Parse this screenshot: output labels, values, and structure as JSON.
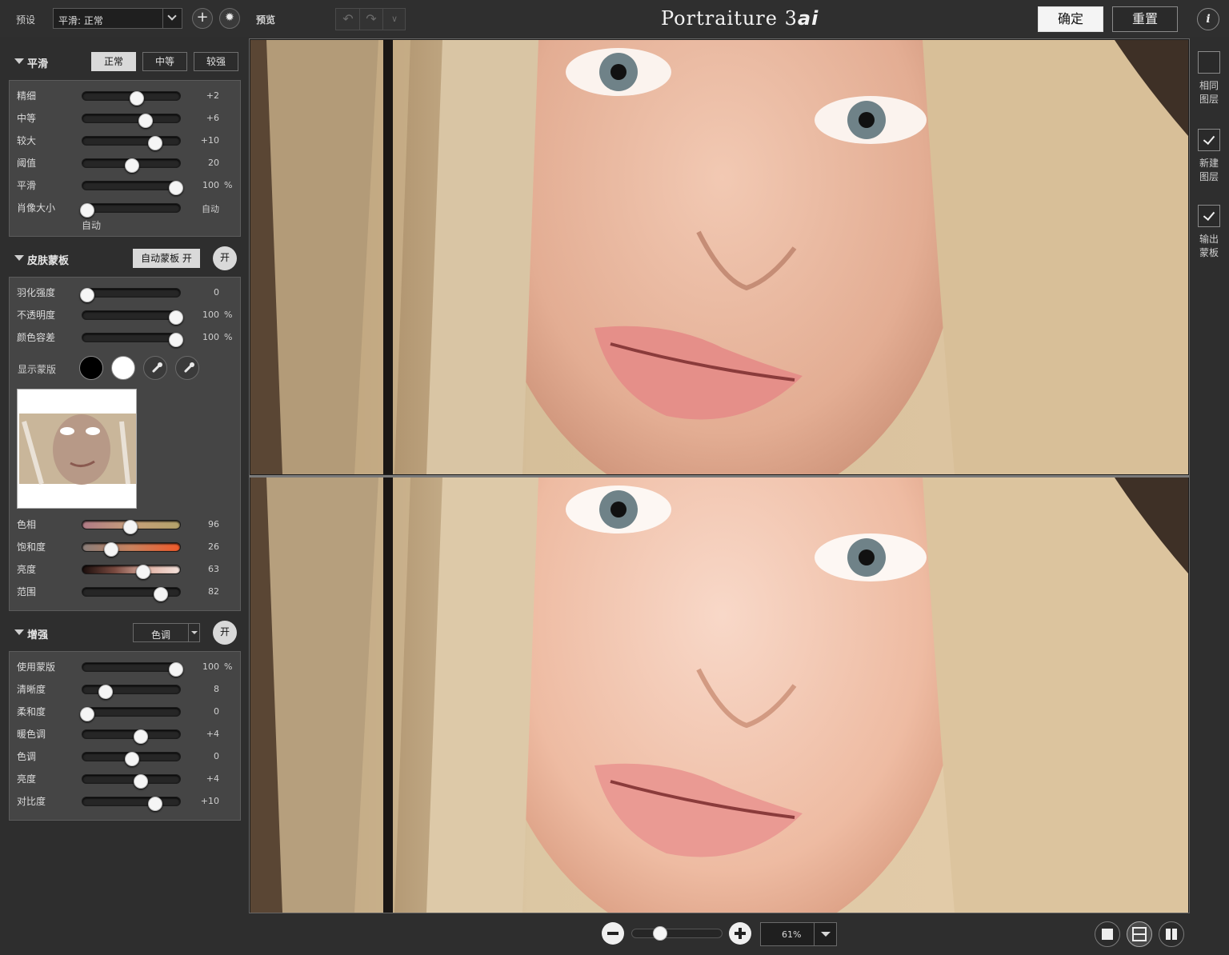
{
  "topbar": {
    "preset_label": "预设",
    "preset_value": "平滑: 正常",
    "preview_label": "预览",
    "app_title_main": "Portraiture 3",
    "app_title_suffix": "ai",
    "ok_label": "确定",
    "reset_label": "重置",
    "info_label": "i"
  },
  "smoothing": {
    "title": "平滑",
    "modes": [
      "正常",
      "中等",
      "较强"
    ],
    "active_mode": "正常",
    "sliders": [
      {
        "label": "精细",
        "value": "+2",
        "unit": "",
        "pos": 0.55
      },
      {
        "label": "中等",
        "value": "+6",
        "unit": "",
        "pos": 0.64
      },
      {
        "label": "较大",
        "value": "+10",
        "unit": "",
        "pos": 0.73
      },
      {
        "label": "阈值",
        "value": "20",
        "unit": "",
        "pos": 0.5
      },
      {
        "label": "平滑",
        "value": "100",
        "unit": "%",
        "pos": 0.94
      },
      {
        "label": "肖像大小",
        "value": "自动",
        "unit": "",
        "pos": 0.05
      }
    ],
    "portrait_size_sub": "自动"
  },
  "skin_mask": {
    "title": "皮肤蒙板",
    "auto_mask_label": "自动蒙板 开",
    "on_label": "开",
    "sliders": [
      {
        "label": "羽化强度",
        "value": "0",
        "unit": "",
        "pos": 0.05
      },
      {
        "label": "不透明度",
        "value": "100",
        "unit": "%",
        "pos": 0.94
      },
      {
        "label": "颜色容差",
        "value": "100",
        "unit": "%",
        "pos": 0.94
      }
    ],
    "show_mask_label": "显示蒙版",
    "color_sliders": [
      {
        "label": "色相",
        "value": "96",
        "pos": 0.48
      },
      {
        "label": "饱和度",
        "value": "26",
        "pos": 0.29
      },
      {
        "label": "亮度",
        "value": "63",
        "pos": 0.61
      },
      {
        "label": "范围",
        "value": "82",
        "pos": 0.79
      }
    ]
  },
  "enhance": {
    "title": "增强",
    "dropdown_value": "色调",
    "on_label": "开",
    "sliders": [
      {
        "label": "使用蒙版",
        "value": "100",
        "unit": "%",
        "pos": 0.94
      },
      {
        "label": "清晰度",
        "value": "8",
        "unit": "",
        "pos": 0.23
      },
      {
        "label": "柔和度",
        "value": "0",
        "unit": "",
        "pos": 0.05
      },
      {
        "label": "暖色调",
        "value": "+4",
        "unit": "",
        "pos": 0.59
      },
      {
        "label": "色调",
        "value": "0",
        "unit": "",
        "pos": 0.5
      },
      {
        "label": "亮度",
        "value": "+4",
        "unit": "",
        "pos": 0.59
      },
      {
        "label": "对比度",
        "value": "+10",
        "unit": "",
        "pos": 0.73
      }
    ]
  },
  "right_rail": [
    {
      "label_line1": "相同",
      "label_line2": "图层",
      "checked": false
    },
    {
      "label_line1": "新建",
      "label_line2": "图层",
      "checked": true
    },
    {
      "label_line1": "输出",
      "label_line2": "蒙板",
      "checked": true
    }
  ],
  "bottombar": {
    "zoom_value": "61%",
    "zoom_pos": 0.31
  },
  "colors": {
    "accent": "#d9d9d9",
    "panel_bg": "#454545",
    "app_bg": "#2e2e2e"
  }
}
